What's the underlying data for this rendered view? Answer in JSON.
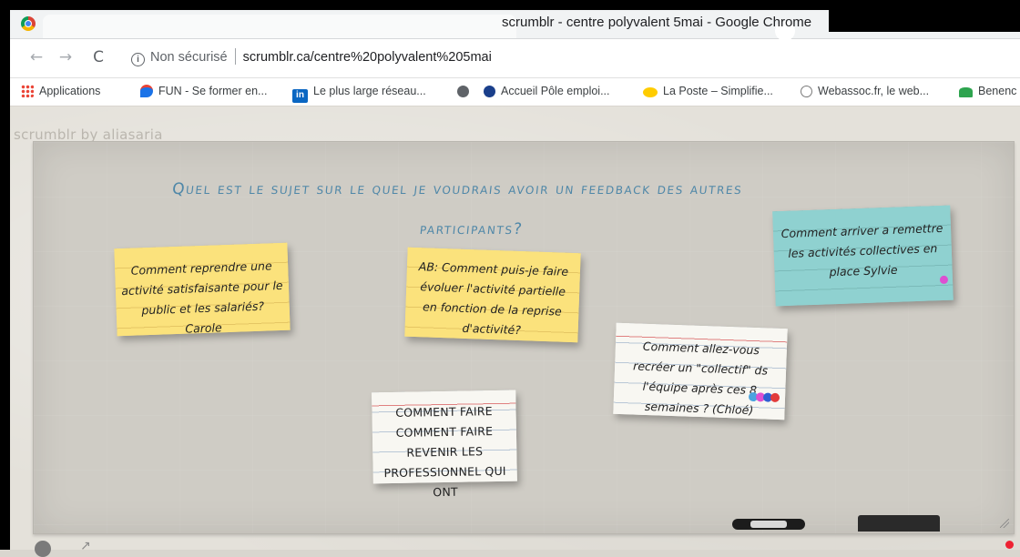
{
  "window": {
    "title": "scrumblr - centre polyvalent 5mai - Google Chrome"
  },
  "navbar": {
    "back_glyph": "←",
    "forward_glyph": "→",
    "reload_glyph": "C",
    "info_glyph": "i",
    "security_label": "Non sécurisé",
    "url": "scrumblr.ca/centre%20polyvalent%205mai"
  },
  "bookmarks": [
    {
      "label": "Applications",
      "icon": "apps-grid-icon"
    },
    {
      "label": "FUN - Se former en...",
      "icon": "fun-icon"
    },
    {
      "label": "Le plus large réseau...",
      "icon": "linkedin-icon",
      "glyph": "in"
    },
    {
      "label": "",
      "icon": "globe-icon"
    },
    {
      "label": "Accueil Pôle emploi...",
      "icon": "pole-emploi-icon"
    },
    {
      "label": "La Poste – Simplifie...",
      "icon": "la-poste-icon"
    },
    {
      "label": "Webassoc.fr, le web...",
      "icon": "webassoc-icon"
    },
    {
      "label": "Benenc",
      "icon": "benenova-icon"
    }
  ],
  "app": {
    "logo_text": "scrumblr by aliasaria"
  },
  "board": {
    "title_line1": "Quel est le sujet sur le quel je voudrais avoir un feedback des autres",
    "title_line2": "participants?"
  },
  "notes": [
    {
      "text": "Comment reprendre une activité satisfaisante pour le public et les salariés? Carole",
      "color": "yellow"
    },
    {
      "text": "AB: Comment puis-je faire évoluer l'activité partielle en fonction de la reprise d'activité?",
      "color": "yellow"
    },
    {
      "text": "Comment arriver a remettre les activités collectives en place Sylvie",
      "color": "teal"
    },
    {
      "text": "Comment allez-vous recréer un \"collectif\" ds l'équipe après ces 8 semaines ? (Chloé)",
      "color": "white"
    },
    {
      "text": "COMMENT FAIRE COMMENT FAIRE REVENIR LES PROFESSIONNEL QUI ONT",
      "color": "white"
    }
  ],
  "colors": {
    "title_blue": "#4f87a8",
    "note_yellow": "#fbe27c",
    "note_teal": "#8fd1d0",
    "note_white": "#f8f7f2",
    "vote_dots": [
      "#4aa3df",
      "#dd4fd1",
      "#2e5fd3",
      "#e23b3b"
    ]
  }
}
